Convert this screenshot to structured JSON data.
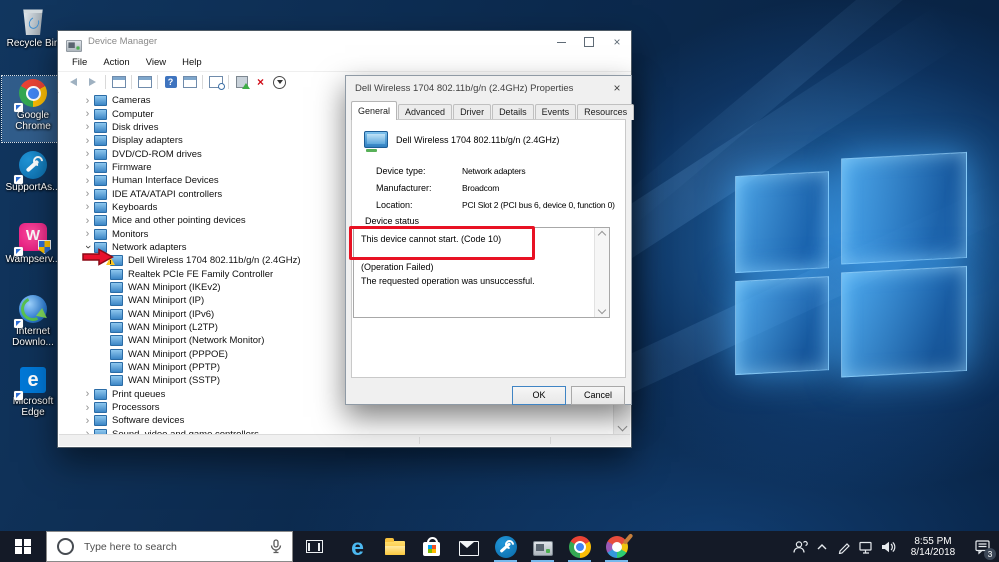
{
  "colors": {
    "accent": "#0078d7",
    "annotation_red": "#e81123",
    "taskbar_bg": "#141a27",
    "running_indicator": "#76b9ed"
  },
  "desktop_icons": [
    {
      "label": "Recycle Bin",
      "art": "recycle-bin"
    },
    {
      "label": "Google Chrome",
      "art": "chrome",
      "shortcut": true,
      "selected": true
    },
    {
      "label": "SupportAs...",
      "art": "supportassist",
      "shortcut": true
    },
    {
      "label": "Wampserv...",
      "art": "wampserver",
      "shortcut": true
    },
    {
      "label": "Internet Downlo...",
      "art": "idm",
      "shortcut": true
    },
    {
      "label": "Microsoft Edge",
      "art": "edge",
      "shortcut": true
    }
  ],
  "device_manager": {
    "title": "Device Manager",
    "menu": [
      "File",
      "Action",
      "View",
      "Help"
    ],
    "tree": [
      {
        "label": "Cameras",
        "state": "collapsed"
      },
      {
        "label": "Computer",
        "state": "collapsed"
      },
      {
        "label": "Disk drives",
        "state": "collapsed"
      },
      {
        "label": "Display adapters",
        "state": "collapsed"
      },
      {
        "label": "DVD/CD-ROM drives",
        "state": "collapsed"
      },
      {
        "label": "Firmware",
        "state": "collapsed"
      },
      {
        "label": "Human Interface Devices",
        "state": "collapsed"
      },
      {
        "label": "IDE ATA/ATAPI controllers",
        "state": "collapsed"
      },
      {
        "label": "Keyboards",
        "state": "collapsed"
      },
      {
        "label": "Mice and other pointing devices",
        "state": "collapsed"
      },
      {
        "label": "Monitors",
        "state": "collapsed"
      },
      {
        "label": "Network adapters",
        "state": "expanded"
      },
      {
        "label": "Dell Wireless 1704 802.11b/g/n (2.4GHz)",
        "level": 2,
        "warning": true
      },
      {
        "label": "Realtek PCIe FE Family Controller",
        "level": 2
      },
      {
        "label": "WAN Miniport (IKEv2)",
        "level": 2
      },
      {
        "label": "WAN Miniport (IP)",
        "level": 2
      },
      {
        "label": "WAN Miniport (IPv6)",
        "level": 2
      },
      {
        "label": "WAN Miniport (L2TP)",
        "level": 2
      },
      {
        "label": "WAN Miniport (Network Monitor)",
        "level": 2
      },
      {
        "label": "WAN Miniport (PPPOE)",
        "level": 2
      },
      {
        "label": "WAN Miniport (PPTP)",
        "level": 2
      },
      {
        "label": "WAN Miniport (SSTP)",
        "level": 2
      },
      {
        "label": "Print queues",
        "state": "collapsed"
      },
      {
        "label": "Processors",
        "state": "collapsed"
      },
      {
        "label": "Software devices",
        "state": "collapsed"
      },
      {
        "label": "Sound, video and game controllers",
        "state": "collapsed"
      }
    ]
  },
  "properties_dialog": {
    "title": "Dell Wireless 1704 802.11b/g/n (2.4GHz) Properties",
    "tabs": [
      {
        "label": "General",
        "active": true
      },
      {
        "label": "Advanced"
      },
      {
        "label": "Driver"
      },
      {
        "label": "Details"
      },
      {
        "label": "Events"
      },
      {
        "label": "Resources"
      }
    ],
    "device_name": "Dell Wireless 1704 802.11b/g/n (2.4GHz)",
    "fields": [
      {
        "label": "Device type:",
        "value": "Network adapters"
      },
      {
        "label": "Manufacturer:",
        "value": "Broadcom"
      },
      {
        "label": "Location:",
        "value": "PCI Slot 2 (PCI bus 6, device 0, function 0)"
      }
    ],
    "status_group_label": "Device status",
    "status_lines": [
      "This device cannot start. (Code 10)",
      "",
      "(Operation Failed)",
      "The requested operation was unsuccessful."
    ],
    "ok_label": "OK",
    "cancel_label": "Cancel"
  },
  "taskbar": {
    "search_placeholder": "Type here to search",
    "apps": [
      {
        "art": "edge"
      },
      {
        "art": "file-explorer"
      },
      {
        "art": "store"
      },
      {
        "art": "mail"
      },
      {
        "art": "supportassist",
        "running": true
      },
      {
        "art": "device-manager",
        "running": true
      },
      {
        "art": "chrome",
        "running": true
      },
      {
        "art": "paint",
        "running": true
      }
    ],
    "clock_time": "8:55 PM",
    "clock_date": "8/14/2018",
    "notification_count": "3"
  }
}
